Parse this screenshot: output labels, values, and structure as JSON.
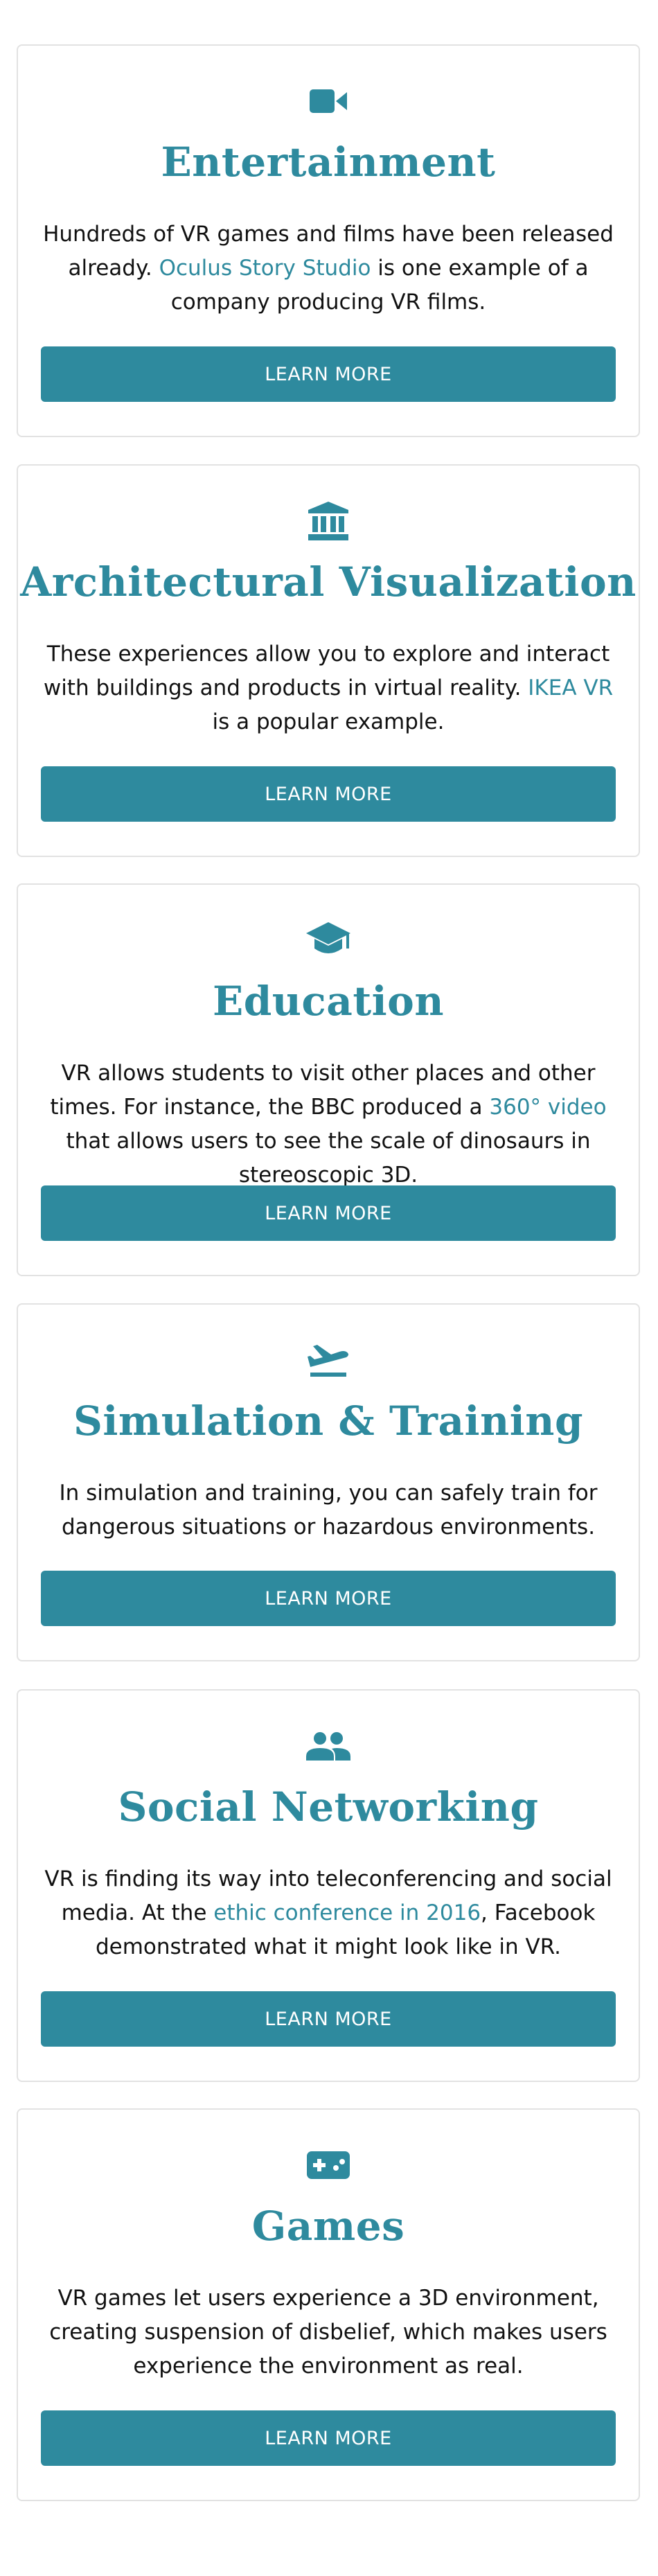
{
  "colors": {
    "accent": "#2e8a9e",
    "text": "#111111",
    "card_border": "#e2e2e2",
    "button_text": "#ffffff"
  },
  "cards": [
    {
      "icon": "video-camera-icon",
      "title": "Entertainment",
      "desc_1": "Hundreds of VR games and films have been released already. ",
      "link": "Oculus Story Studio",
      "desc_2": " is one example of a company producing VR films.",
      "button": "LEARN MORE"
    },
    {
      "icon": "institution-icon",
      "title": "Architectural Visualization",
      "desc_1": "These experiences allow you to explore and interact with buildings and products in virtual reality. ",
      "link": "IKEA VR",
      "desc_2": " is a popular example.",
      "button": "LEARN MORE"
    },
    {
      "icon": "graduation-cap-icon",
      "title": "Education",
      "desc_1": "VR allows students to visit other places and other times. For instance, the BBC produced a ",
      "link": "360° video",
      "desc_2": " that allows users to see the scale of dinosaurs in stereoscopic 3D.",
      "button": "LEARN MORE"
    },
    {
      "icon": "airplane-takeoff-icon",
      "title": "Simulation & Training",
      "desc_1": "In simulation and training, you can safely train for dangerous situations or hazardous environments.",
      "button": "LEARN MORE"
    },
    {
      "icon": "people-icon",
      "title": "Social Networking",
      "desc_1": "VR is finding its way into teleconferencing and social media. At the ",
      "link": "ethic conference in 2016",
      "desc_2": ", Facebook demonstrated what it might look like in VR.",
      "button": "LEARN MORE"
    },
    {
      "icon": "gamepad-icon",
      "title": "Games",
      "desc_1": "VR games let users experience a 3D environment, creating suspension of disbelief, which makes users experience the environment as real.",
      "button": "LEARN MORE"
    }
  ]
}
